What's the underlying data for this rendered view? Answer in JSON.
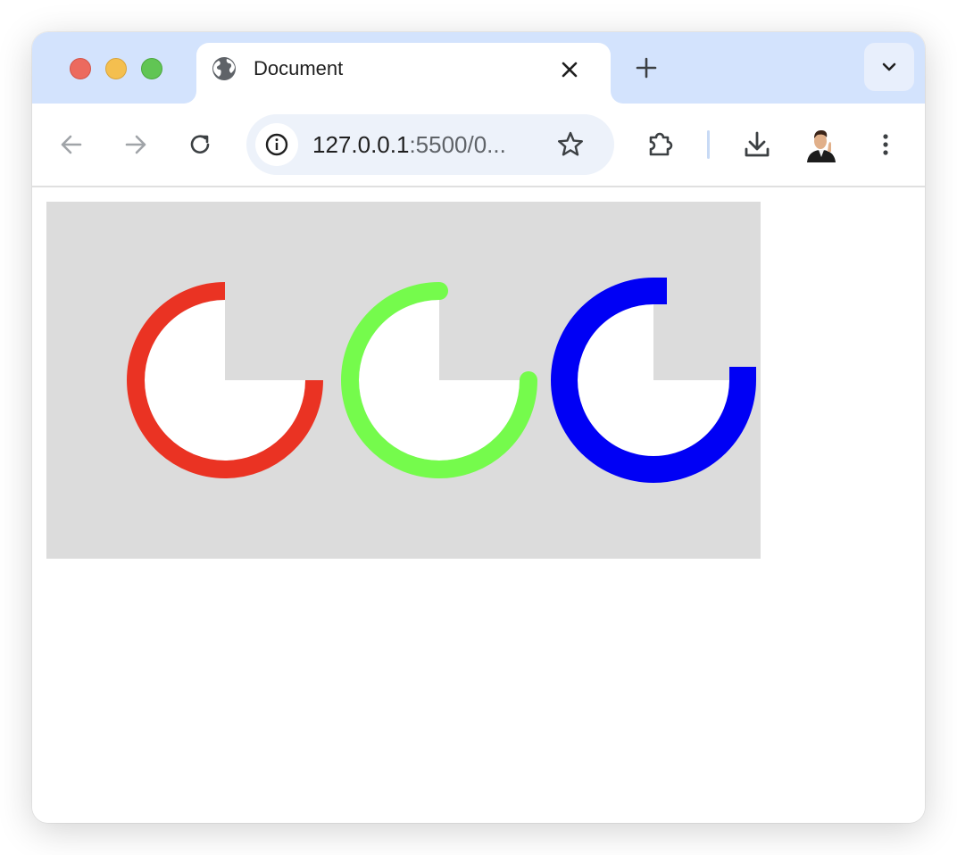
{
  "browser": {
    "tab": {
      "title": "Document",
      "favicon": "globe-icon"
    },
    "address_bar": {
      "host": "127.0.0.1",
      "rest": ":5500/0..."
    },
    "icons": {
      "back": "arrow-left-icon",
      "forward": "arrow-right-icon",
      "reload": "reload-icon",
      "site_info": "info-icon",
      "bookmark": "star-icon",
      "extensions": "puzzle-icon",
      "download": "download-icon",
      "profile": "avatar",
      "menu": "kebab-menu-icon",
      "new_tab": "plus-icon",
      "tab_search": "chevron-down-icon",
      "close_tab": "close-icon"
    }
  },
  "canvas": {
    "background": "#dcdcdc",
    "arcs": [
      {
        "name": "red",
        "color": "#ea3323",
        "cap": "butt",
        "sweep_degrees": 270
      },
      {
        "name": "green",
        "color": "#75fb4c",
        "cap": "round",
        "sweep_degrees": 270
      },
      {
        "name": "blue",
        "color": "#0000f5",
        "cap": "square",
        "sweep_degrees": 270
      }
    ]
  }
}
